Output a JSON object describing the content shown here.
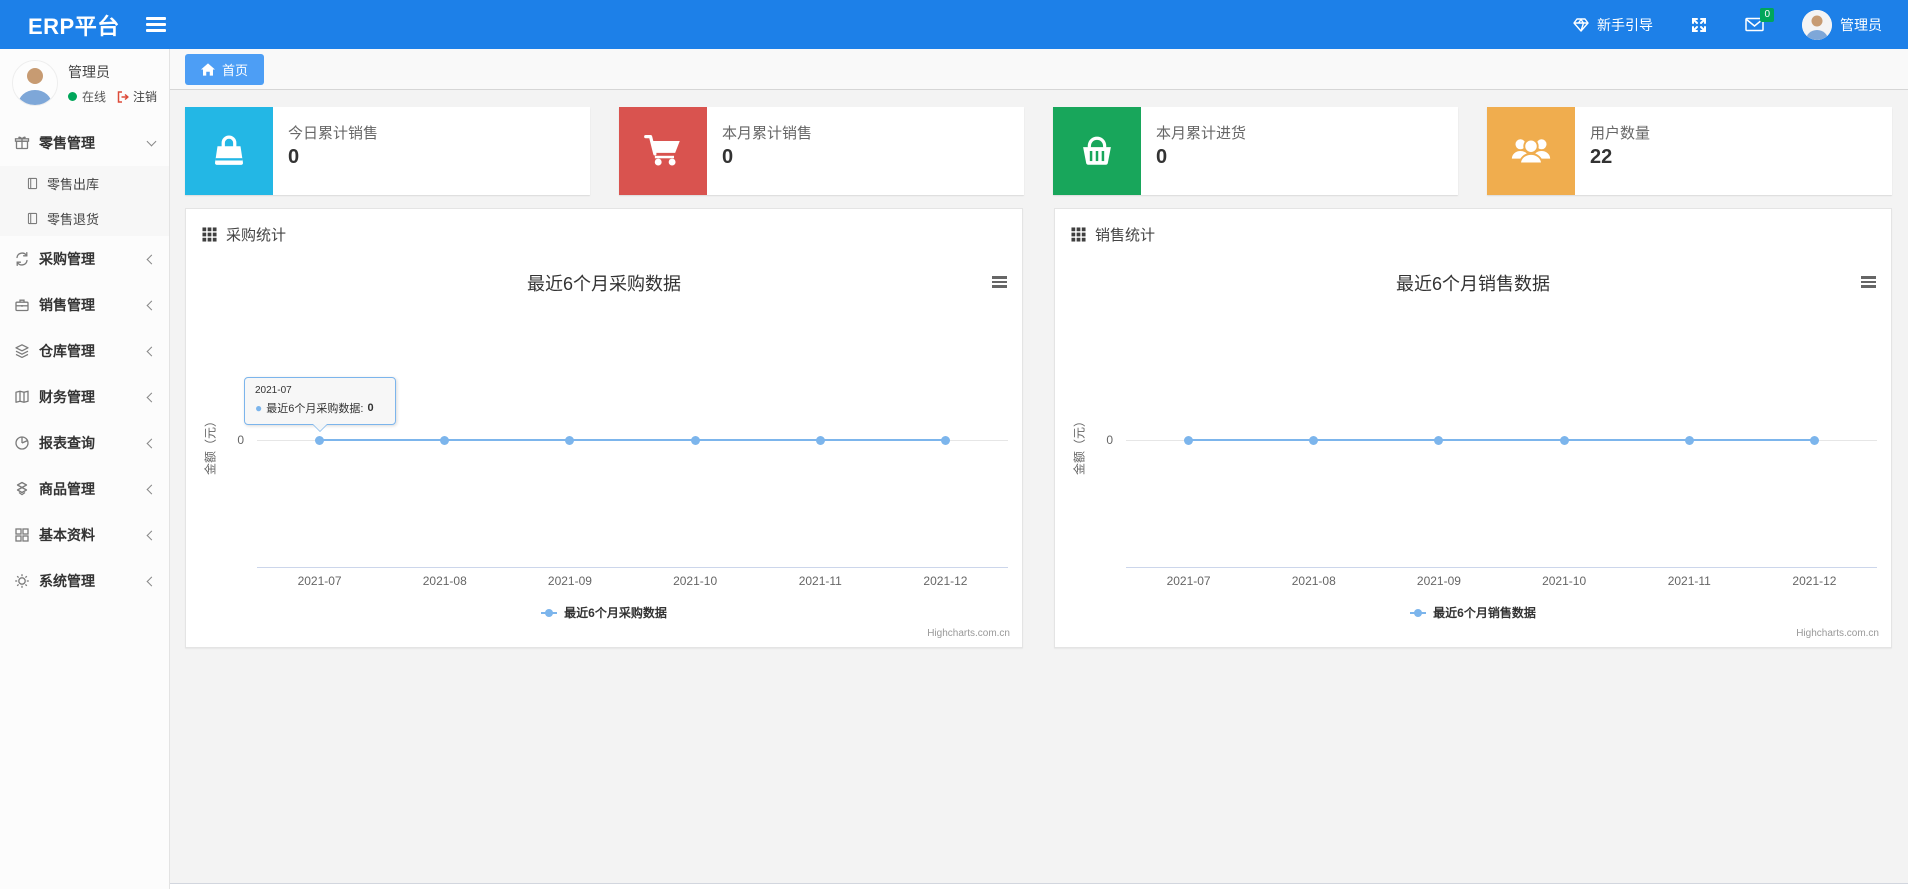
{
  "topbar": {
    "brand": "ERP平台",
    "guide_label": "新手引导",
    "mail_badge": "0",
    "user_name": "管理员"
  },
  "sidebar": {
    "user": {
      "name": "管理员",
      "status": "在线",
      "logout": "注销"
    },
    "menu": [
      {
        "label": "零售管理",
        "icon": "gift-icon",
        "state": "expanded"
      },
      {
        "label": "零售出库",
        "icon": "journal-icon"
      },
      {
        "label": "零售退货",
        "icon": "journal-icon"
      },
      {
        "label": "采购管理",
        "icon": "refresh-icon",
        "state": "collapsed"
      },
      {
        "label": "销售管理",
        "icon": "briefcase-icon",
        "state": "collapsed"
      },
      {
        "label": "仓库管理",
        "icon": "layers-icon",
        "state": "collapsed"
      },
      {
        "label": "财务管理",
        "icon": "book-icon",
        "state": "collapsed"
      },
      {
        "label": "报表查询",
        "icon": "pie-chart-icon",
        "state": "collapsed"
      },
      {
        "label": "商品管理",
        "icon": "cubes-icon",
        "state": "collapsed"
      },
      {
        "label": "基本资料",
        "icon": "grid-icon",
        "state": "collapsed"
      },
      {
        "label": "系统管理",
        "icon": "gear-icon",
        "state": "collapsed"
      }
    ]
  },
  "tab_home": "首页",
  "cards": [
    {
      "label": "今日累计销售",
      "value": "0",
      "color": "#23b7e5",
      "icon": "shopping-bag-icon"
    },
    {
      "label": "本月累计销售",
      "value": "0",
      "color": "#d9534f",
      "icon": "cart-icon"
    },
    {
      "label": "本月累计进货",
      "value": "0",
      "color": "#18a65b",
      "icon": "basket-icon"
    },
    {
      "label": "用户数量",
      "value": "22",
      "color": "#f0ad4e",
      "icon": "users-icon"
    }
  ],
  "panels": [
    {
      "title": "采购统计"
    },
    {
      "title": "销售统计"
    }
  ],
  "chart_data": [
    {
      "type": "line",
      "title": "最近6个月采购数据",
      "categories": [
        "2021-07",
        "2021-08",
        "2021-09",
        "2021-10",
        "2021-11",
        "2021-12"
      ],
      "series": [
        {
          "name": "最近6个月采购数据",
          "values": [
            0,
            0,
            0,
            0,
            0,
            0
          ]
        }
      ],
      "xlabel": "",
      "ylabel": "金额（元）",
      "yticks": [
        "0"
      ],
      "ylim": [
        0,
        0
      ],
      "grid": true,
      "legend_position": "bottom",
      "line_color": "#7cb5ec",
      "credit": "Highcharts.com.cn",
      "tooltip": {
        "category": "2021-07",
        "series_label": "最近6个月采购数据:",
        "value": "0"
      }
    },
    {
      "type": "line",
      "title": "最近6个月销售数据",
      "categories": [
        "2021-07",
        "2021-08",
        "2021-09",
        "2021-10",
        "2021-11",
        "2021-12"
      ],
      "series": [
        {
          "name": "最近6个月销售数据",
          "values": [
            0,
            0,
            0,
            0,
            0,
            0
          ]
        }
      ],
      "xlabel": "",
      "ylabel": "金额（元）",
      "yticks": [
        "0"
      ],
      "ylim": [
        0,
        0
      ],
      "grid": true,
      "legend_position": "bottom",
      "line_color": "#7cb5ec",
      "credit": "Highcharts.com.cn"
    }
  ]
}
